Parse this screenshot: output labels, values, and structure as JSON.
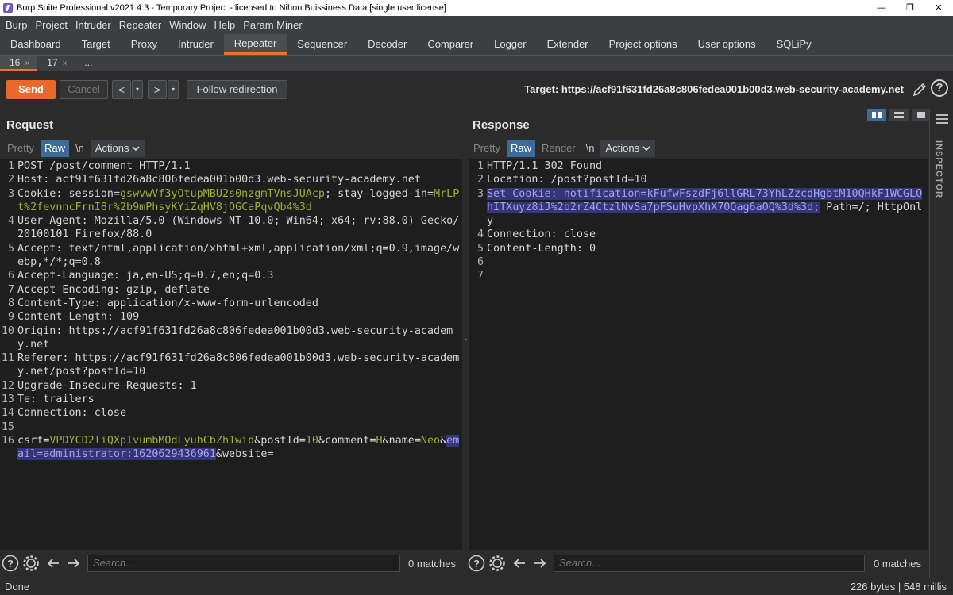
{
  "window": {
    "title": "Burp Suite Professional v2021.4.3 - Temporary Project - licensed to Nihon Buissiness Data [single user license]",
    "controls": [
      "—",
      "❐",
      "✕"
    ]
  },
  "menu": [
    "Burp",
    "Project",
    "Intruder",
    "Repeater",
    "Window",
    "Help",
    "Param Miner"
  ],
  "tool_tabs": [
    "Dashboard",
    "Target",
    "Proxy",
    "Intruder",
    "Repeater",
    "Sequencer",
    "Decoder",
    "Comparer",
    "Logger",
    "Extender",
    "Project options",
    "User options",
    "SQLiPy"
  ],
  "active_tool_tab": "Repeater",
  "repeater_tabs": [
    {
      "label": "16",
      "close": "×"
    },
    {
      "label": "17",
      "close": "×"
    },
    {
      "label": "...",
      "close": ""
    }
  ],
  "toolbar": {
    "send": "Send",
    "cancel": "Cancel",
    "back": "<",
    "forward": ">",
    "dropdown": "▾",
    "follow": "Follow redirection",
    "target": "Target: https://acf91f631fd26a8c806fedea001b00d3.web-security-academy.net",
    "help": "?"
  },
  "request": {
    "title": "Request",
    "tabs": {
      "pretty": "Pretty",
      "raw": "Raw",
      "newline": "\\n",
      "actions": "Actions"
    },
    "lines": [
      {
        "n": "1",
        "parts": [
          {
            "t": "POST /post/comment HTTP/1.1",
            "c": ""
          }
        ]
      },
      {
        "n": "2",
        "parts": [
          {
            "t": "Host: ",
            "c": ""
          },
          {
            "t": "acf91f631fd26a8c806fedea001b00d3.web-security-academy.net",
            "c": ""
          }
        ]
      },
      {
        "n": "3",
        "parts": [
          {
            "t": "Cookie: session=",
            "c": ""
          },
          {
            "t": "gswvwVf3yOtupMBU2s0nzgmTVnsJUAcp",
            "c": "green"
          },
          {
            "t": "; stay-logged-in=",
            "c": ""
          },
          {
            "t": "MrLPt%2fevnncFrnI8r%2b9mPhsyKYiZqHV8jOGCaPqvQb4%3d",
            "c": "green"
          }
        ]
      },
      {
        "n": "4",
        "parts": [
          {
            "t": "User-Agent: Mozilla/5.0 (Windows NT 10.0; Win64; x64; rv:88.0) Gecko/20100101 Firefox/88.0",
            "c": ""
          }
        ]
      },
      {
        "n": "5",
        "parts": [
          {
            "t": "Accept: text/html,application/xhtml+xml,application/xml;q=0.9,image/webp,*/*;q=0.8",
            "c": ""
          }
        ]
      },
      {
        "n": "6",
        "parts": [
          {
            "t": "Accept-Language: ja,en-US;q=0.7,en;q=0.3",
            "c": ""
          }
        ]
      },
      {
        "n": "7",
        "parts": [
          {
            "t": "Accept-Encoding: gzip, deflate",
            "c": ""
          }
        ]
      },
      {
        "n": "8",
        "parts": [
          {
            "t": "Content-Type: application/x-www-form-urlencoded",
            "c": ""
          }
        ]
      },
      {
        "n": "9",
        "parts": [
          {
            "t": "Content-Length: 109",
            "c": ""
          }
        ]
      },
      {
        "n": "10",
        "parts": [
          {
            "t": "Origin: https://acf91f631fd26a8c806fedea001b00d3.web-security-academy.net",
            "c": ""
          }
        ]
      },
      {
        "n": "11",
        "parts": [
          {
            "t": "Referer: https://acf91f631fd26a8c806fedea001b00d3.web-security-academy.net/post?postId=10",
            "c": ""
          }
        ]
      },
      {
        "n": "12",
        "parts": [
          {
            "t": "Upgrade-Insecure-Requests: 1",
            "c": ""
          }
        ]
      },
      {
        "n": "13",
        "parts": [
          {
            "t": "Te: trailers",
            "c": ""
          }
        ]
      },
      {
        "n": "14",
        "parts": [
          {
            "t": "Connection: close",
            "c": ""
          }
        ]
      },
      {
        "n": "15",
        "parts": [
          {
            "t": "",
            "c": ""
          }
        ]
      },
      {
        "n": "16",
        "parts": [
          {
            "t": "csrf=",
            "c": ""
          },
          {
            "t": "VPDYCD2liQXpIvumbMOdLyuhCbZh1wid",
            "c": "green"
          },
          {
            "t": "&postId=",
            "c": ""
          },
          {
            "t": "10",
            "c": "green"
          },
          {
            "t": "&comment=",
            "c": ""
          },
          {
            "t": "H",
            "c": "green"
          },
          {
            "t": "&name=",
            "c": ""
          },
          {
            "t": "Neo",
            "c": "green"
          },
          {
            "t": "&",
            "c": ""
          },
          {
            "t": "email=administrator:1620629436961",
            "c": "hl"
          },
          {
            "t": "&website=",
            "c": ""
          }
        ]
      }
    ],
    "search_placeholder": "Search...",
    "matches": "0 matches"
  },
  "response": {
    "title": "Response",
    "tabs": {
      "pretty": "Pretty",
      "raw": "Raw",
      "render": "Render",
      "newline": "\\n",
      "actions": "Actions"
    },
    "lines": [
      {
        "n": "1",
        "parts": [
          {
            "t": "HTTP/1.1 302 Found",
            "c": ""
          }
        ]
      },
      {
        "n": "2",
        "parts": [
          {
            "t": "Location: /post?postId=10",
            "c": ""
          }
        ]
      },
      {
        "n": "3",
        "parts": [
          {
            "t": "Set-Cookie: notification=kFufwFszdFj6llGRL73YhLZzcdHgbtM10QHkF1WCGLQhITXuyz8iJ%2b2rZ4CtzlNvSa7pFSuHvpXhX70Qag6aOQ%3d%3d;",
            "c": "hl"
          },
          {
            "t": " Path=/; HttpOnly",
            "c": ""
          }
        ]
      },
      {
        "n": "4",
        "parts": [
          {
            "t": "Connection: close",
            "c": ""
          }
        ]
      },
      {
        "n": "5",
        "parts": [
          {
            "t": "Content-Length: 0",
            "c": ""
          }
        ]
      },
      {
        "n": "6",
        "parts": [
          {
            "t": "",
            "c": ""
          }
        ]
      },
      {
        "n": "7",
        "parts": [
          {
            "t": "",
            "c": ""
          }
        ]
      }
    ],
    "search_placeholder": "Search...",
    "matches": "0 matches"
  },
  "inspector_label": "INSPECTOR",
  "status": {
    "left": "Done",
    "right": "226 bytes | 548 millis"
  },
  "colors": {
    "accent": "#e8722f",
    "send": "#e8692a",
    "selected_tab": "#3d6b99",
    "value_green": "#98b030",
    "highlight_bg": "#35357a"
  }
}
